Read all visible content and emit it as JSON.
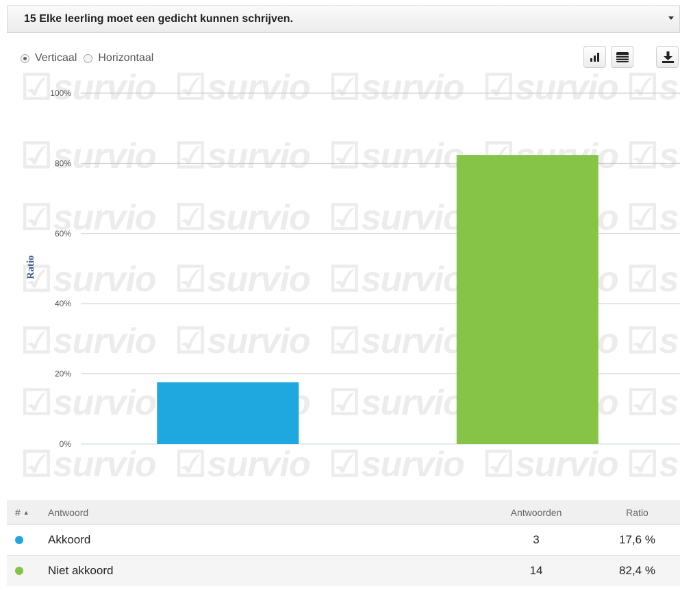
{
  "question": {
    "title": "15 Elke leerling moet een gedicht kunnen schrijven."
  },
  "controls": {
    "orientation_options": [
      {
        "label": "Verticaal",
        "selected": true
      },
      {
        "label": "Horizontaal",
        "selected": false
      }
    ],
    "icons": [
      "bar-chart-icon",
      "table-icon",
      "download-icon"
    ]
  },
  "watermark": "survio",
  "chart_data": {
    "type": "bar",
    "categories": [
      "Akkoord",
      "Niet akkoord"
    ],
    "values": [
      17.6,
      82.4
    ],
    "colors": [
      "#1fa8e0",
      "#86c448"
    ],
    "ylabel": "Ratio",
    "ylim": [
      0,
      100
    ],
    "yticks": [
      "0%",
      "20%",
      "40%",
      "60%",
      "80%",
      "100%"
    ],
    "grid": true
  },
  "table": {
    "headers": {
      "num": "#",
      "answer": "Antwoord",
      "count": "Antwoorden",
      "ratio": "Ratio"
    },
    "rows": [
      {
        "answer": "Akkoord",
        "count": "3",
        "ratio": "17,6 %",
        "color": "#1fa8e0"
      },
      {
        "answer": "Niet akkoord",
        "count": "14",
        "ratio": "82,4 %",
        "color": "#86c448"
      }
    ]
  }
}
